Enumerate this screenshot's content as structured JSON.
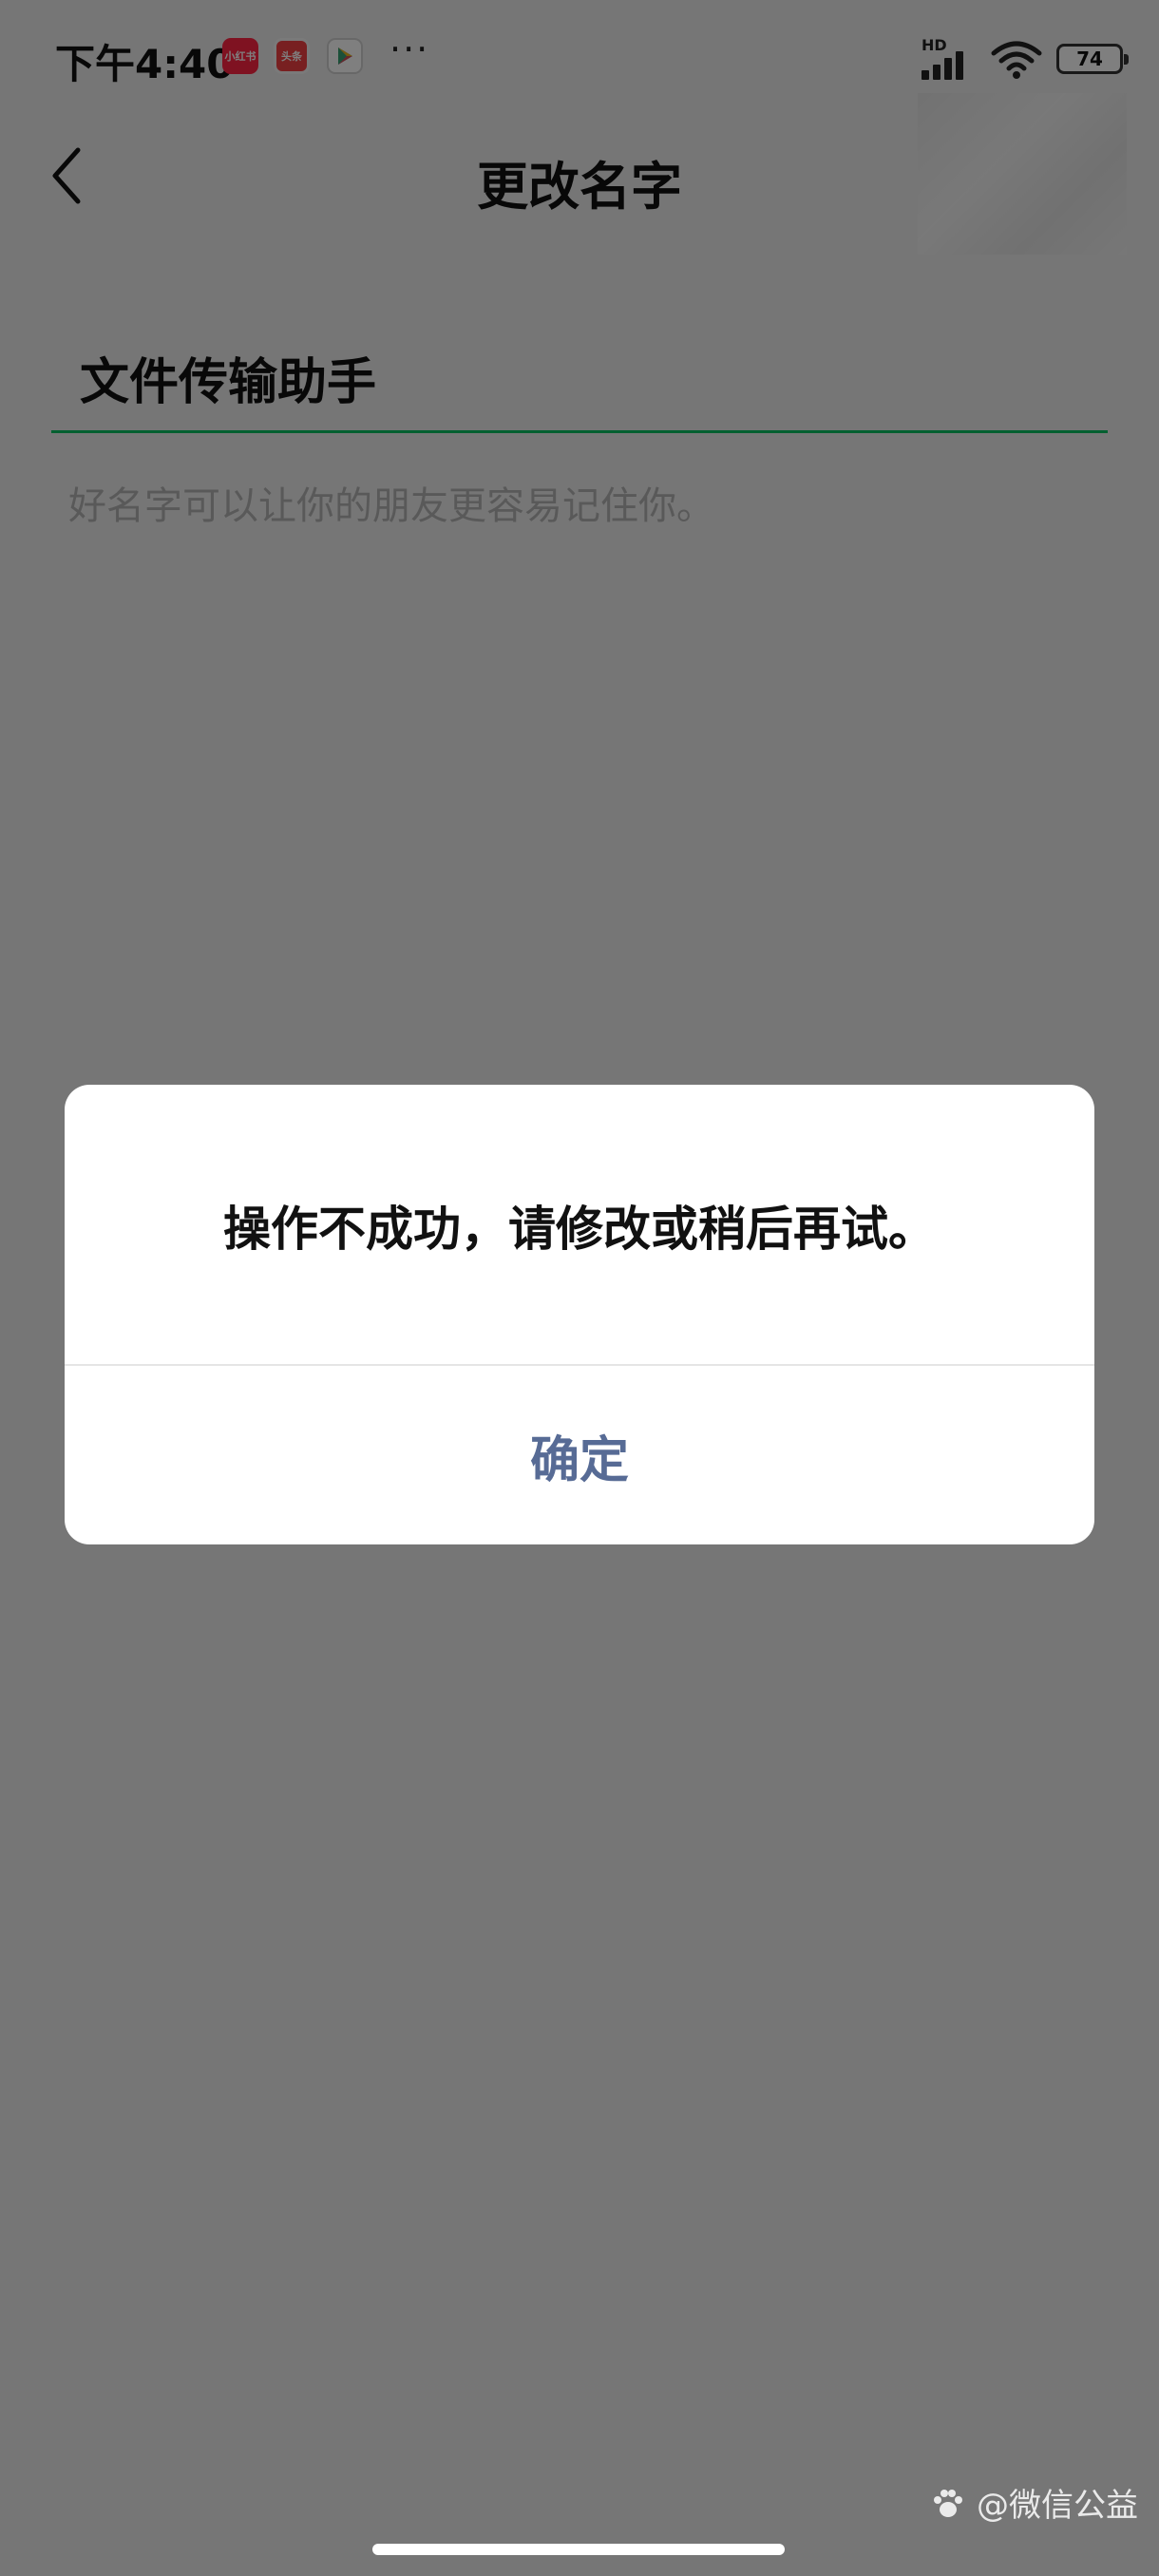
{
  "status_bar": {
    "time": "下午4:40",
    "notifications": [
      {
        "name": "xiaohongshu-icon",
        "label": "小红书"
      },
      {
        "name": "toutiao-icon",
        "label": "头条"
      },
      {
        "name": "play-store-icon",
        "label": ""
      }
    ],
    "more": "···",
    "network_label": "HD",
    "battery": "74"
  },
  "nav": {
    "title": "更改名字",
    "back_icon": "chevron-left-icon"
  },
  "form": {
    "name_value": "文件传输助手",
    "hint": "好名字可以让你的朋友更容易记住你。",
    "accent_color": "#07c160"
  },
  "dialog": {
    "message": "操作不成功，请修改或稍后再试。",
    "confirm_label": "确定",
    "confirm_color": "#576b95"
  },
  "watermark": {
    "text": "@微信公益"
  }
}
